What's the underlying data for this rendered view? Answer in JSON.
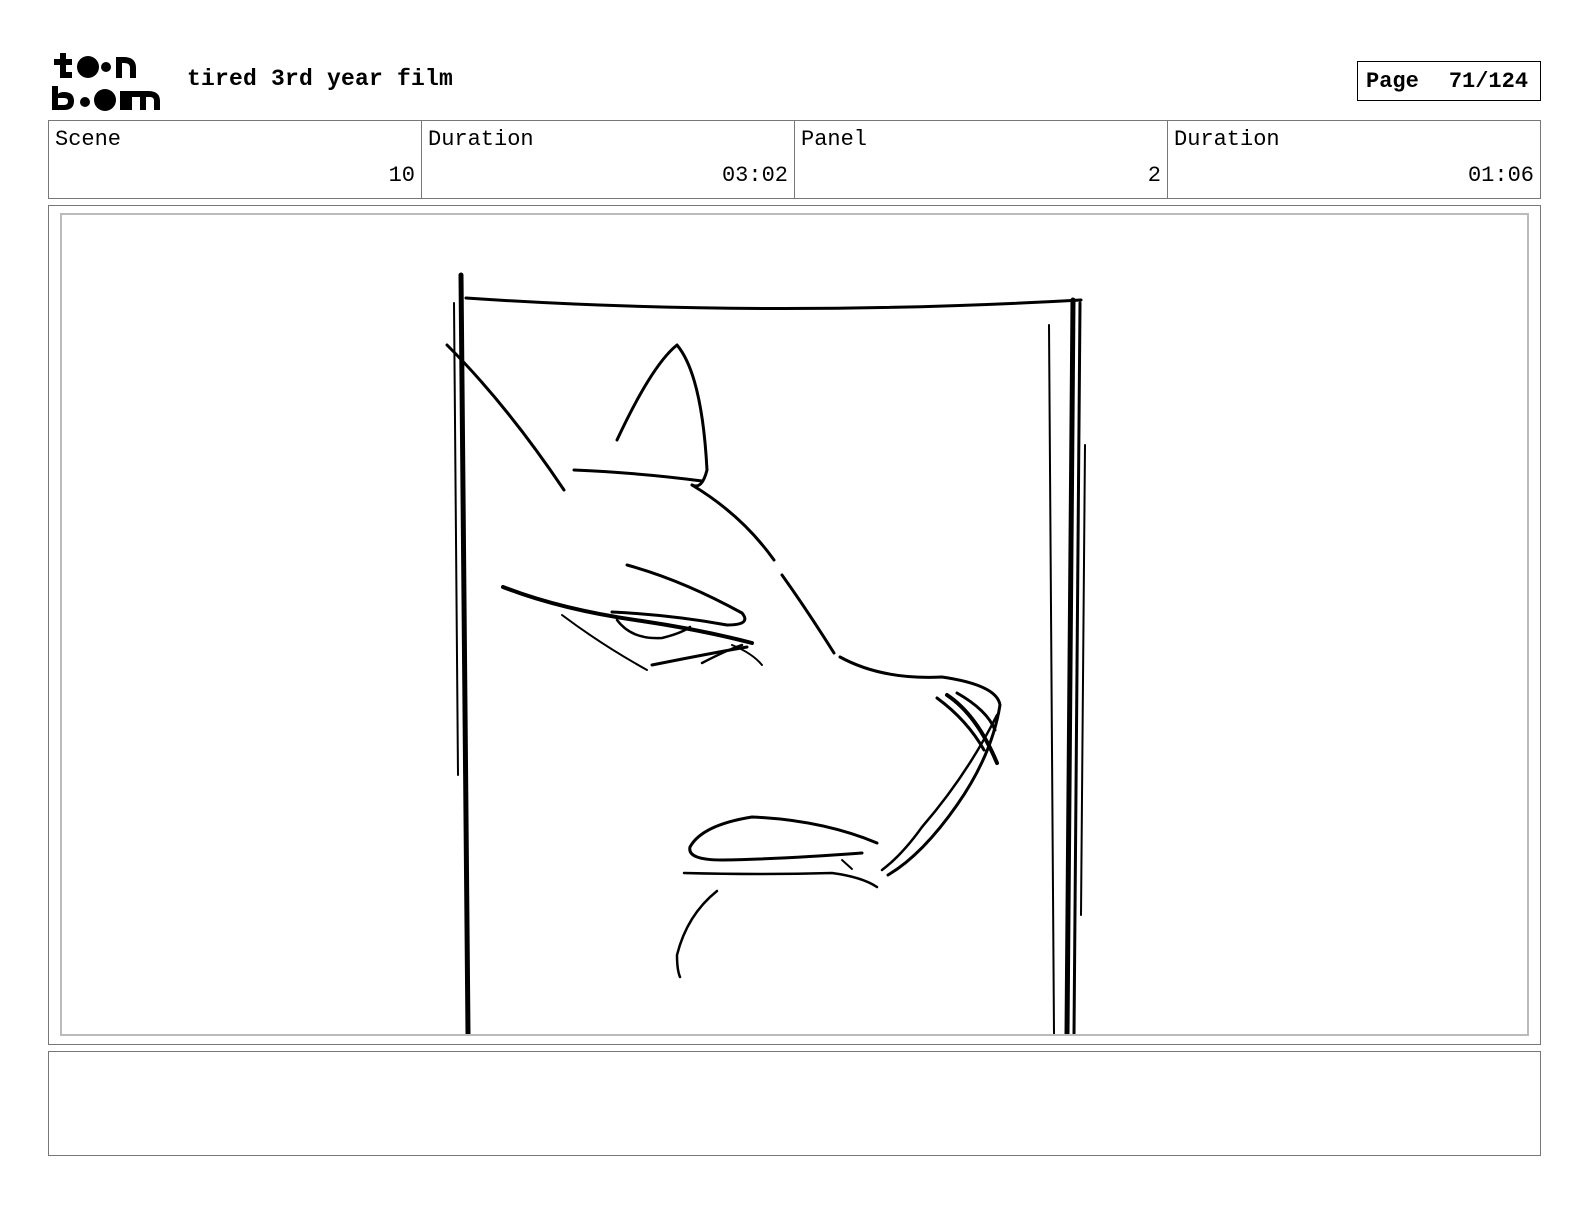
{
  "brand": {
    "logo_text_top": "toon",
    "logo_text_bottom": "boom"
  },
  "header": {
    "title": "tired 3rd year film",
    "page_label": "Page",
    "page_number": "71/124"
  },
  "info": {
    "scene_label": "Scene",
    "scene_value": "10",
    "scene_duration_label": "Duration",
    "scene_duration_value": "03:02",
    "panel_label": "Panel",
    "panel_value": "2",
    "panel_duration_label": "Duration",
    "panel_duration_value": "01:06"
  },
  "panel": {
    "image": "sketch-fox-face-in-doorway"
  },
  "notes": {
    "text": ""
  }
}
